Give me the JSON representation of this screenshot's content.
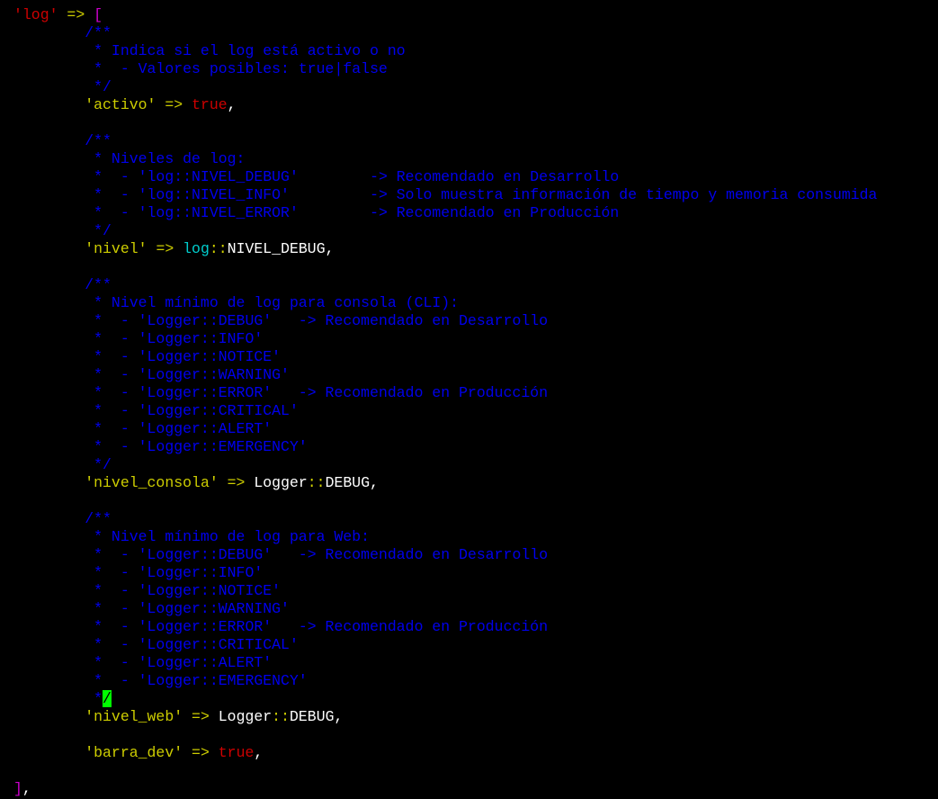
{
  "editor": {
    "colors": {
      "background": "#000000",
      "comment": "#0000ee",
      "string": "#cdcd00",
      "keyword": "#cd0000",
      "operator": "#cdcd00",
      "class": "#00cdcd",
      "plain": "#ffffff",
      "bracket": "#cd00cd",
      "cursor": "#00ff00"
    },
    "lines": [
      [
        {
          "t": "'log'",
          "c": "keyword"
        },
        {
          "t": " ",
          "c": "plain"
        },
        {
          "t": "=>",
          "c": "operator"
        },
        {
          "t": " ",
          "c": "plain"
        },
        {
          "t": "[",
          "c": "bracket"
        }
      ],
      [
        {
          "t": "        /**",
          "c": "comment"
        }
      ],
      [
        {
          "t": "         * Indica si el log está activo o no",
          "c": "comment"
        }
      ],
      [
        {
          "t": "         *  - Valores posibles: true|false",
          "c": "comment"
        }
      ],
      [
        {
          "t": "         */",
          "c": "comment"
        }
      ],
      [
        {
          "t": "        ",
          "c": "plain"
        },
        {
          "t": "'activo'",
          "c": "string"
        },
        {
          "t": " ",
          "c": "plain"
        },
        {
          "t": "=>",
          "c": "operator"
        },
        {
          "t": " ",
          "c": "plain"
        },
        {
          "t": "true",
          "c": "keyword"
        },
        {
          "t": ",",
          "c": "plain"
        }
      ],
      [],
      [
        {
          "t": "        /**",
          "c": "comment"
        }
      ],
      [
        {
          "t": "         * Niveles de log:",
          "c": "comment"
        }
      ],
      [
        {
          "t": "         *  - 'log::NIVEL_DEBUG'        -> Recomendado en Desarrollo",
          "c": "comment"
        }
      ],
      [
        {
          "t": "         *  - 'log::NIVEL_INFO'         -> Solo muestra información de tiempo y memoria consumida",
          "c": "comment"
        }
      ],
      [
        {
          "t": "         *  - 'log::NIVEL_ERROR'        -> Recomendado en Producción",
          "c": "comment"
        }
      ],
      [
        {
          "t": "         */",
          "c": "comment"
        }
      ],
      [
        {
          "t": "        ",
          "c": "plain"
        },
        {
          "t": "'nivel'",
          "c": "string"
        },
        {
          "t": " ",
          "c": "plain"
        },
        {
          "t": "=>",
          "c": "operator"
        },
        {
          "t": " ",
          "c": "plain"
        },
        {
          "t": "log",
          "c": "class"
        },
        {
          "t": "::",
          "c": "operator"
        },
        {
          "t": "NIVEL_DEBUG,",
          "c": "plain"
        }
      ],
      [],
      [
        {
          "t": "        /**",
          "c": "comment"
        }
      ],
      [
        {
          "t": "         * Nivel mínimo de log para consola (CLI):",
          "c": "comment"
        }
      ],
      [
        {
          "t": "         *  - 'Logger::DEBUG'   -> Recomendado en Desarrollo",
          "c": "comment"
        }
      ],
      [
        {
          "t": "         *  - 'Logger::INFO'",
          "c": "comment"
        }
      ],
      [
        {
          "t": "         *  - 'Logger::NOTICE'",
          "c": "comment"
        }
      ],
      [
        {
          "t": "         *  - 'Logger::WARNING'",
          "c": "comment"
        }
      ],
      [
        {
          "t": "         *  - 'Logger::ERROR'   -> Recomendado en Producción",
          "c": "comment"
        }
      ],
      [
        {
          "t": "         *  - 'Logger::CRITICAL'",
          "c": "comment"
        }
      ],
      [
        {
          "t": "         *  - 'Logger::ALERT'",
          "c": "comment"
        }
      ],
      [
        {
          "t": "         *  - 'Logger::EMERGENCY'",
          "c": "comment"
        }
      ],
      [
        {
          "t": "         */",
          "c": "comment"
        }
      ],
      [
        {
          "t": "        ",
          "c": "plain"
        },
        {
          "t": "'nivel_consola'",
          "c": "string"
        },
        {
          "t": " ",
          "c": "plain"
        },
        {
          "t": "=>",
          "c": "operator"
        },
        {
          "t": " Logger",
          "c": "plain"
        },
        {
          "t": "::",
          "c": "operator"
        },
        {
          "t": "DEBUG,",
          "c": "plain"
        }
      ],
      [],
      [
        {
          "t": "        /**",
          "c": "comment"
        }
      ],
      [
        {
          "t": "         * Nivel mínimo de log para Web:",
          "c": "comment"
        }
      ],
      [
        {
          "t": "         *  - 'Logger::DEBUG'   -> Recomendado en Desarrollo",
          "c": "comment"
        }
      ],
      [
        {
          "t": "         *  - 'Logger::INFO'",
          "c": "comment"
        }
      ],
      [
        {
          "t": "         *  - 'Logger::NOTICE'",
          "c": "comment"
        }
      ],
      [
        {
          "t": "         *  - 'Logger::WARNING'",
          "c": "comment"
        }
      ],
      [
        {
          "t": "         *  - 'Logger::ERROR'   -> Recomendado en Producción",
          "c": "comment"
        }
      ],
      [
        {
          "t": "         *  - 'Logger::CRITICAL'",
          "c": "comment"
        }
      ],
      [
        {
          "t": "         *  - 'Logger::ALERT'",
          "c": "comment"
        }
      ],
      [
        {
          "t": "         *  - 'Logger::EMERGENCY'",
          "c": "comment"
        }
      ],
      [
        {
          "t": "         *",
          "c": "comment"
        },
        {
          "t": "/",
          "c": "cursor"
        }
      ],
      [
        {
          "t": "        ",
          "c": "plain"
        },
        {
          "t": "'nivel_web'",
          "c": "string"
        },
        {
          "t": " ",
          "c": "plain"
        },
        {
          "t": "=>",
          "c": "operator"
        },
        {
          "t": " Logger",
          "c": "plain"
        },
        {
          "t": "::",
          "c": "operator"
        },
        {
          "t": "DEBUG,",
          "c": "plain"
        }
      ],
      [],
      [
        {
          "t": "        ",
          "c": "plain"
        },
        {
          "t": "'barra_dev'",
          "c": "string"
        },
        {
          "t": " ",
          "c": "plain"
        },
        {
          "t": "=>",
          "c": "operator"
        },
        {
          "t": " ",
          "c": "plain"
        },
        {
          "t": "true",
          "c": "keyword"
        },
        {
          "t": ",",
          "c": "plain"
        }
      ],
      [],
      [
        {
          "t": "]",
          "c": "bracket"
        },
        {
          "t": ",",
          "c": "plain"
        }
      ]
    ]
  }
}
